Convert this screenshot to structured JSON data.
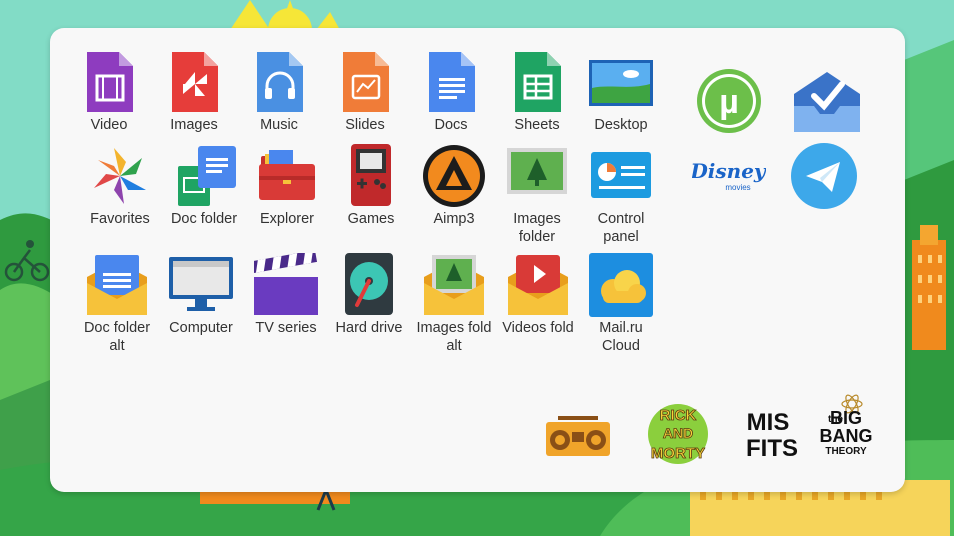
{
  "apps": [
    {
      "label": "Video",
      "icon": "video-file-icon"
    },
    {
      "label": "Images",
      "icon": "images-file-icon"
    },
    {
      "label": "Music",
      "icon": "music-file-icon"
    },
    {
      "label": "Slides",
      "icon": "slides-file-icon"
    },
    {
      "label": "Docs",
      "icon": "docs-file-icon"
    },
    {
      "label": "Sheets",
      "icon": "sheets-file-icon"
    },
    {
      "label": "Desktop",
      "icon": "desktop-wallpaper-icon"
    },
    {
      "label": "Favorites",
      "icon": "favorites-pinwheel-icon"
    },
    {
      "label": "Doc folder",
      "icon": "doc-folder-icon"
    },
    {
      "label": "Explorer",
      "icon": "explorer-folder-icon"
    },
    {
      "label": "Games",
      "icon": "gameboy-icon"
    },
    {
      "label": "Aimp3",
      "icon": "aimp-player-icon"
    },
    {
      "label": "Images\nfolder",
      "icon": "images-folder-icon"
    },
    {
      "label": "Control\npanel",
      "icon": "control-panel-icon"
    },
    {
      "label": "Doc folder\nalt",
      "icon": "doc-folder-alt-icon"
    },
    {
      "label": "Computer",
      "icon": "computer-monitor-icon"
    },
    {
      "label": "TV series",
      "icon": "clapperboard-icon"
    },
    {
      "label": "Hard drive",
      "icon": "hard-drive-icon"
    },
    {
      "label": "Images fold\nalt",
      "icon": "images-folder-alt-icon"
    },
    {
      "label": "Videos fold",
      "icon": "videos-folder-icon"
    },
    {
      "label": "Mail.ru\nCloud",
      "icon": "mailru-cloud-icon"
    }
  ],
  "extras": [
    {
      "icon": "utorrent-icon",
      "glyph": "µ"
    },
    {
      "icon": "inbox-check-icon"
    },
    {
      "icon": "disney-movies-logo",
      "text": "Disney",
      "subtext": "movies"
    },
    {
      "icon": "telegram-icon"
    }
  ],
  "badges": [
    {
      "icon": "boombox-icon"
    },
    {
      "icon": "rick-and-morty-logo",
      "text": "RICK AND MORTY"
    },
    {
      "icon": "misfits-logo",
      "text": "MIS FITS"
    },
    {
      "icon": "big-bang-theory-logo",
      "text": "the BIG BANG THEORY"
    }
  ],
  "colors": {
    "panel": "#f8f8f8",
    "sky": "#7fdcc3",
    "grass": "#3aaa45",
    "label": "#333333"
  }
}
